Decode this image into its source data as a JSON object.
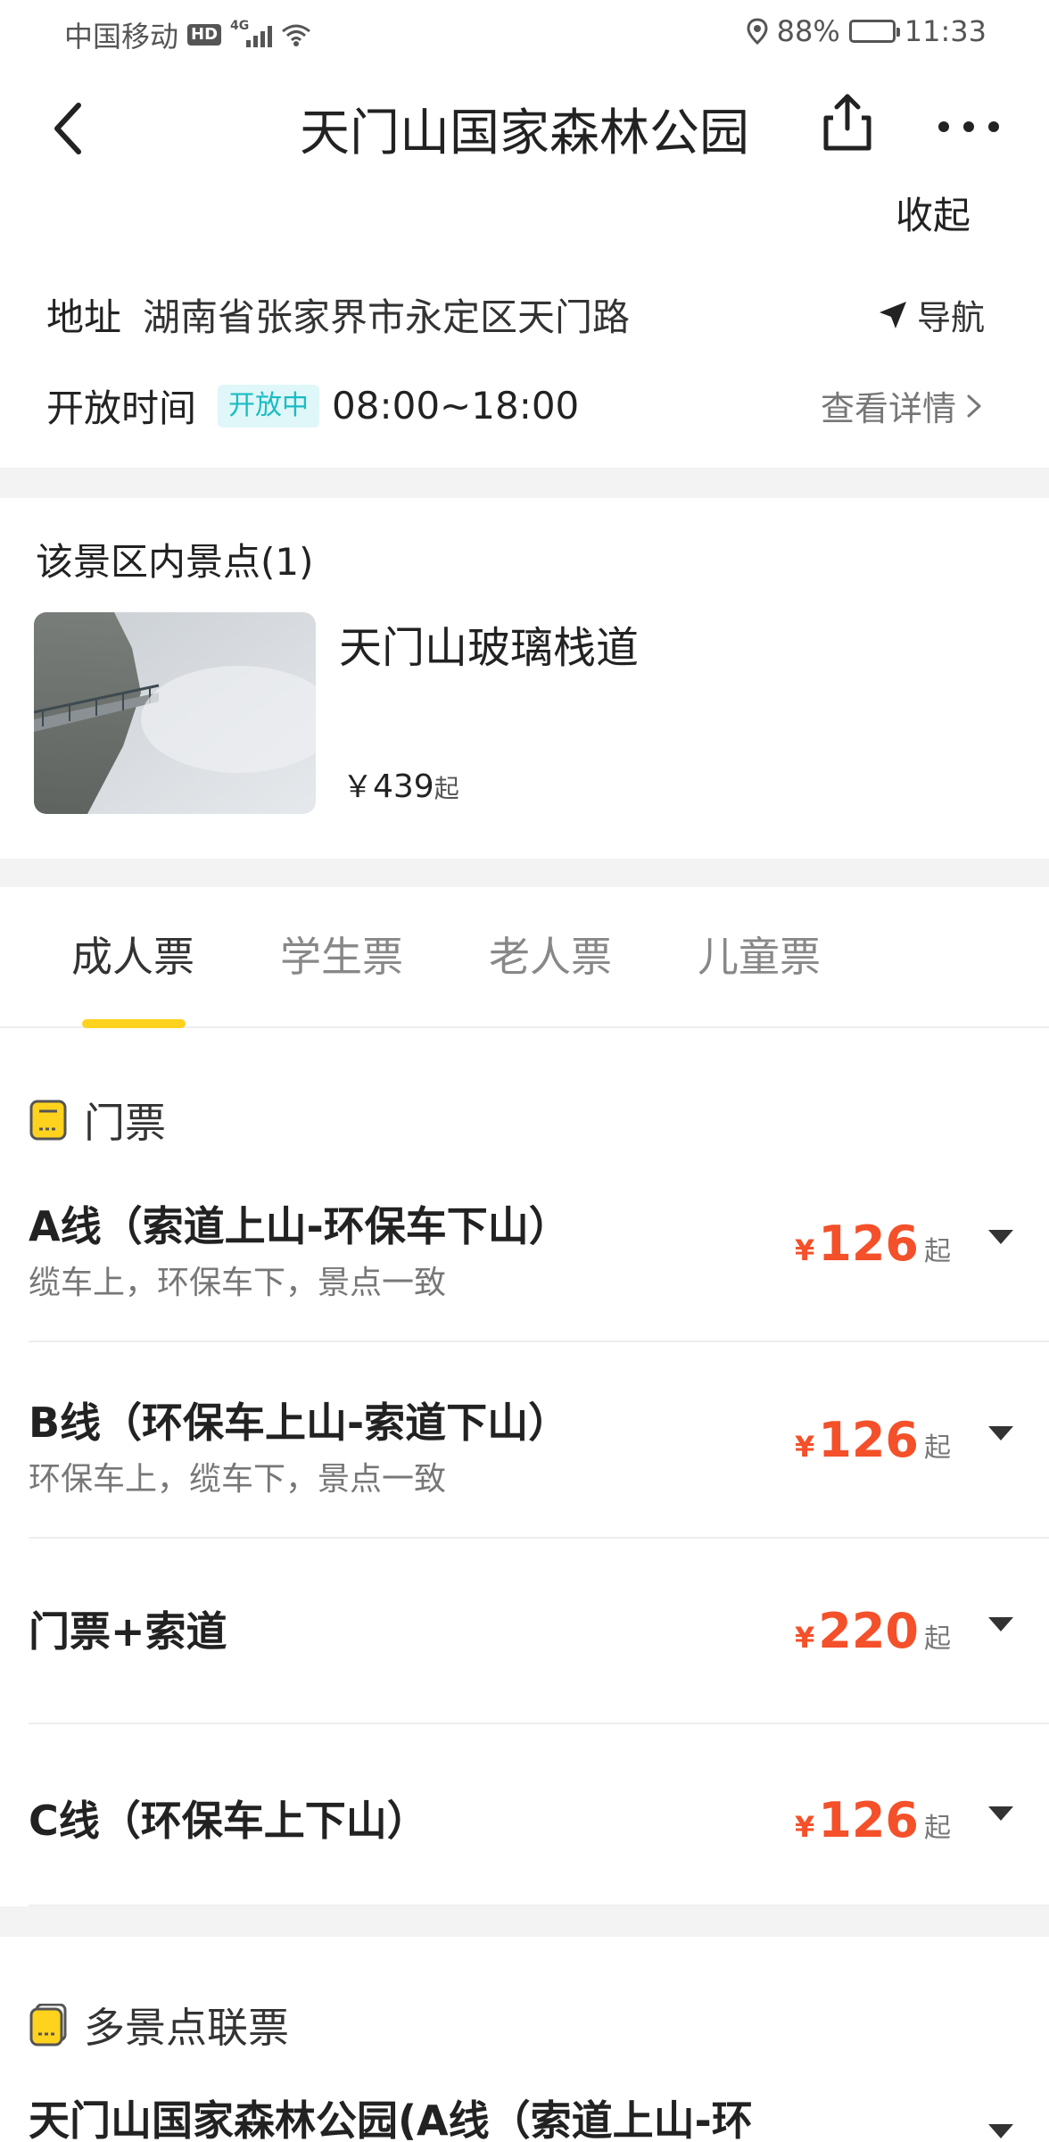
{
  "status_bar": {
    "carrier": "中国移动",
    "hd": "HD",
    "network": "4G",
    "battery": "88%",
    "time": "11:33"
  },
  "nav": {
    "title": "天门山国家森林公园",
    "collapse": "收起"
  },
  "info": {
    "address_label": "地址",
    "address": "湖南省张家界市永定区天门路",
    "navigate": "导航",
    "hours_label": "开放时间",
    "open_status": "开放中",
    "hours": "08:00~18:00",
    "detail_link": "查看详情"
  },
  "scenic": {
    "title": "该景区内景点(1)",
    "spots": [
      {
        "name": "天门山玻璃栈道",
        "currency": "￥",
        "price": "439",
        "suffix": "起"
      }
    ]
  },
  "tabs": [
    "成人票",
    "学生票",
    "老人票",
    "儿童票"
  ],
  "ticket_section": {
    "title": "门票",
    "items": [
      {
        "name": "A线（索道上山-环保车下山）",
        "sub": "缆车上，环保车下，景点一致",
        "currency": "¥",
        "price": "126",
        "suffix": "起"
      },
      {
        "name": "B线（环保车上山-索道下山）",
        "sub": "环保车上，缆车下，景点一致",
        "currency": "¥",
        "price": "126",
        "suffix": "起"
      },
      {
        "name": "门票+索道",
        "sub": "",
        "currency": "¥",
        "price": "220",
        "suffix": "起"
      },
      {
        "name": "C线（环保车上下山）",
        "sub": "",
        "currency": "¥",
        "price": "126",
        "suffix": "起"
      }
    ]
  },
  "combo_section": {
    "title": "多景点联票",
    "first_item": "天门山国家森林公园(A线（索道上山-环"
  },
  "colors": {
    "accent_yellow": "#ffd21e",
    "price_red": "#f4502a",
    "open_badge_bg": "#dff7f8",
    "open_badge_text": "#1bbcc4"
  }
}
